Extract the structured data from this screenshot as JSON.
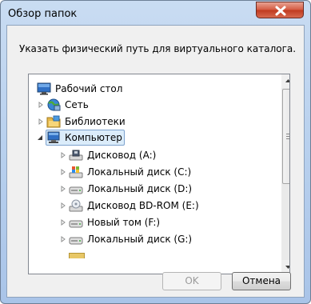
{
  "window": {
    "title": "Обзор папок"
  },
  "dialog": {
    "instruction": "Указать физический путь для виртуального каталога."
  },
  "tree": {
    "items": [
      {
        "label": "Рабочий стол",
        "icon": "desktop-icon",
        "expander": "none"
      },
      {
        "label": "Сеть",
        "icon": "network-icon",
        "expander": "collapsed"
      },
      {
        "label": "Библиотеки",
        "icon": "libraries-icon",
        "expander": "collapsed"
      },
      {
        "label": "Компьютер",
        "icon": "computer-icon",
        "expander": "expanded",
        "selected": true
      },
      {
        "label": "Дисковод (A:)",
        "icon": "floppy-drive-icon",
        "expander": "collapsed"
      },
      {
        "label": "Локальный диск (C:)",
        "icon": "system-drive-icon",
        "expander": "collapsed"
      },
      {
        "label": "Локальный диск (D:)",
        "icon": "hard-drive-icon",
        "expander": "collapsed"
      },
      {
        "label": "Дисковод BD-ROM (E:)",
        "icon": "optical-drive-icon",
        "expander": "collapsed"
      },
      {
        "label": "Новый том (F:)",
        "icon": "hard-drive-icon",
        "expander": "collapsed"
      },
      {
        "label": "Локальный диск (G:)",
        "icon": "hard-drive-icon",
        "expander": "collapsed"
      }
    ]
  },
  "buttons": {
    "ok": "OK",
    "cancel": "Отмена"
  },
  "colors": {
    "selection": "#dbecfa",
    "selection_border": "#7da2ce",
    "close": "#c9462c"
  }
}
